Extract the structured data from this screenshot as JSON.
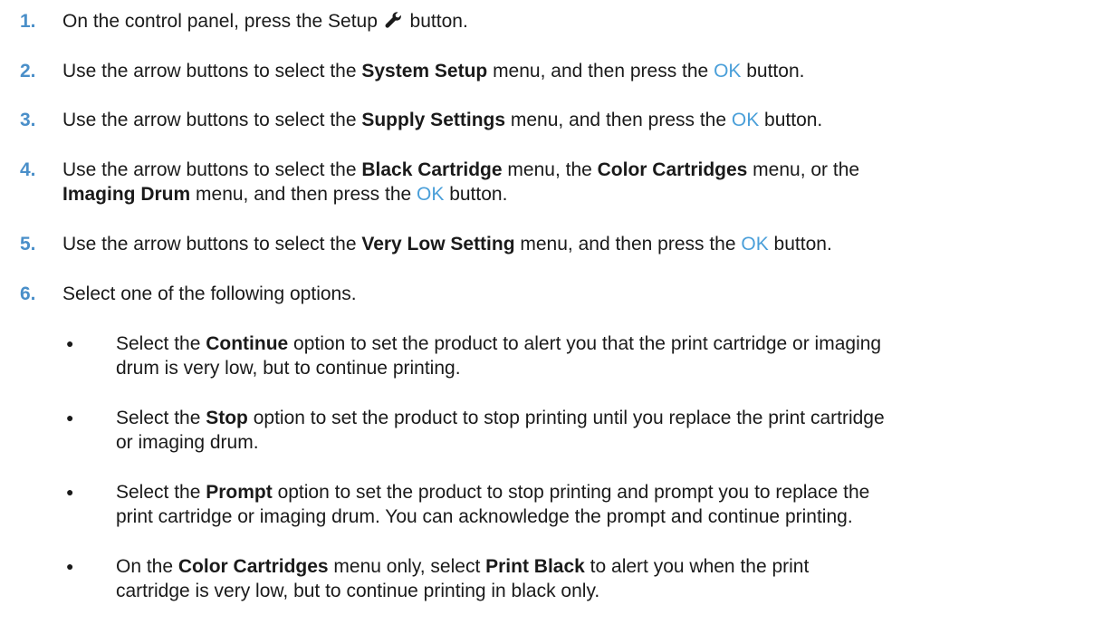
{
  "steps": [
    {
      "num": "1.",
      "parts": [
        "On the control panel, press the Setup ",
        " button."
      ],
      "icon": "wrench-icon"
    },
    {
      "num": "2.",
      "pre": "Use the arrow buttons to select the ",
      "bold": "System Setup",
      "mid": " menu, and then press the ",
      "ok": "OK",
      "post": " button."
    },
    {
      "num": "3.",
      "pre": "Use the arrow buttons to select the ",
      "bold": "Supply Settings",
      "mid": " menu, and then press the ",
      "ok": "OK",
      "post": " button."
    },
    {
      "num": "4.",
      "pre": "Use the arrow buttons to select the ",
      "bold1": "Black Cartridge",
      "mid1": " menu, the ",
      "bold2": "Color Cartridges",
      "mid2": " menu, or the",
      "bold3": "Imaging Drum",
      "mid3": " menu, and then press the ",
      "ok": "OK",
      "post": " button."
    },
    {
      "num": "5.",
      "pre": "Use the arrow buttons to select the ",
      "bold": "Very Low Setting",
      "mid": " menu, and then press the ",
      "ok": "OK",
      "post": " button."
    },
    {
      "num": "6.",
      "text": "Select one of the following options."
    }
  ],
  "bullets": [
    {
      "pre": "Select the ",
      "bold": "Continue",
      "line1": " option to set the product to alert you that the print cartridge or imaging",
      "line2": "drum is very low, but to continue printing."
    },
    {
      "pre": "Select the ",
      "bold": "Stop",
      "line1": " option to set the product to stop printing until you replace the print cartridge",
      "line2": "or imaging drum."
    },
    {
      "pre": "Select the ",
      "bold": "Prompt",
      "line1": " option to set the product to stop printing and prompt you to replace the",
      "line2": "print cartridge or imaging drum. You can acknowledge the prompt and continue printing."
    },
    {
      "pre": "On the ",
      "bold": "Color Cartridges",
      "mid": " menu only, select ",
      "bold2": "Print Black",
      "line1": " to alert you when the print",
      "line2": "cartridge is very low, but to continue printing in black only."
    }
  ],
  "bullet_symbol": "●",
  "colors": {
    "step_number": "#4a8fc9",
    "ok_text": "#4a9fd9",
    "body_text": "#1a1a1a"
  }
}
